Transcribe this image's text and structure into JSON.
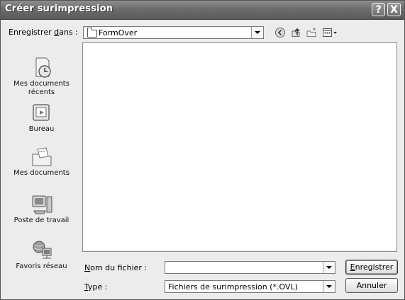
{
  "window": {
    "title": "Créer surimpression",
    "help_label": "?",
    "close_label": "X"
  },
  "lookin": {
    "label_prefix": "Enregistrer ",
    "label_accel": "d",
    "label_suffix": "ans :",
    "value": "FormOver"
  },
  "toolbar": {
    "icons": [
      "back-icon",
      "up-folder-icon",
      "new-folder-icon",
      "view-menu-icon"
    ]
  },
  "places": {
    "items": [
      {
        "label": "Mes documents récents",
        "icon": "recent-documents-icon"
      },
      {
        "label": "Bureau",
        "icon": "desktop-icon"
      },
      {
        "label": "Mes documents",
        "icon": "my-documents-icon"
      },
      {
        "label": "Poste de travail",
        "icon": "my-computer-icon"
      },
      {
        "label": "Favoris réseau",
        "icon": "network-places-icon"
      }
    ]
  },
  "form": {
    "filename_label_accel": "N",
    "filename_label_rest": "om du fichier :",
    "filename_value": "",
    "type_label_accel": "T",
    "type_label_rest": "ype :",
    "type_value": "Fichiers de surimpression (*.OVL)"
  },
  "buttons": {
    "save_accel": "E",
    "save_rest": "nregistrer",
    "cancel": "Annuler"
  }
}
